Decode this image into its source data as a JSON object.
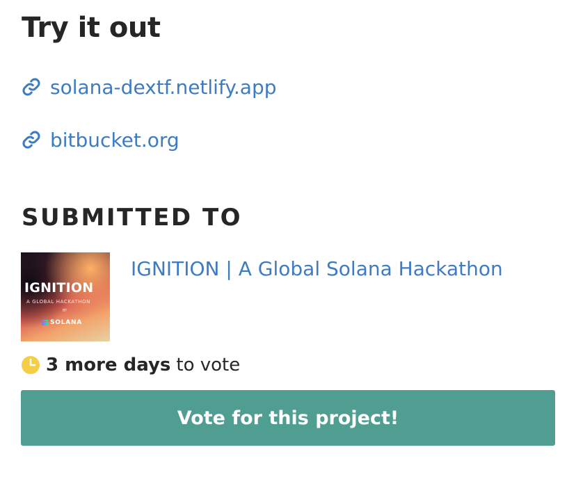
{
  "try_it_out": {
    "title": "Try it out",
    "links": [
      {
        "label": "solana-dextf.netlify.app",
        "icon": "link-icon"
      },
      {
        "label": "bitbucket.org",
        "icon": "link-icon"
      }
    ]
  },
  "submitted": {
    "heading": "SUBMITTED TO",
    "hackathon": {
      "name": "IGNITION | A Global Solana Hackathon",
      "thumbnail": {
        "title": "IGNITION",
        "subtitle": "A GLOBAL HACKATHON",
        "by": "BY",
        "brand": "SOLANA"
      }
    },
    "vote_status": {
      "icon": "clock-icon",
      "days_bold": "3 more days",
      "rest": "to vote"
    },
    "vote_button_label": "Vote for this project!"
  },
  "colors": {
    "link": "#3d7bc2",
    "button": "#4f9e91",
    "clock": "#f5cd47",
    "heading": "#262626"
  }
}
